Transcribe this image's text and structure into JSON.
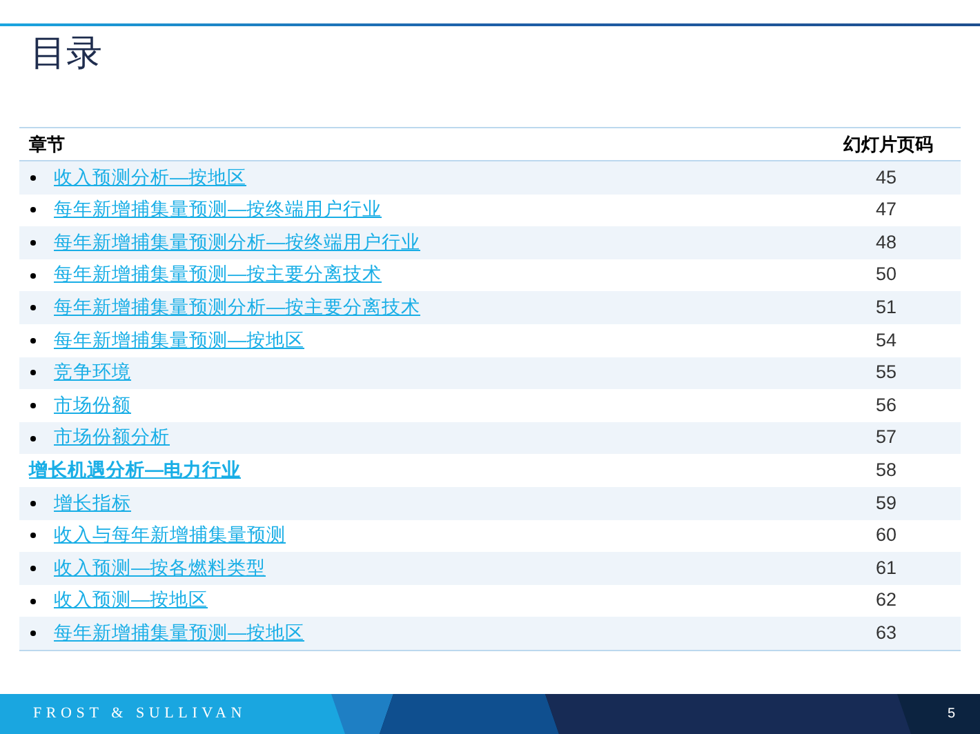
{
  "slide": {
    "title": "目录",
    "page_number": "5",
    "footer_logo": "FROST & SULLIVAN"
  },
  "table": {
    "columns": [
      "章节",
      "幻灯片页码"
    ],
    "rows": [
      {
        "kind": "sub",
        "label": "收入预测分析—按地区",
        "page": "45"
      },
      {
        "kind": "sub",
        "label": "每年新增捕集量预测—按终端用户行业",
        "page": "47"
      },
      {
        "kind": "sub",
        "label": "每年新增捕集量预测分析—按终端用户行业",
        "page": "48"
      },
      {
        "kind": "sub",
        "label": "每年新增捕集量预测—按主要分离技术",
        "page": "50"
      },
      {
        "kind": "sub",
        "label": "每年新增捕集量预测分析—按主要分离技术",
        "page": "51"
      },
      {
        "kind": "sub",
        "label": "每年新增捕集量预测—按地区",
        "page": "54"
      },
      {
        "kind": "sub",
        "label": "竞争环境",
        "page": "55"
      },
      {
        "kind": "sub",
        "label": "市场份额",
        "page": "56"
      },
      {
        "kind": "sub",
        "label": "市场份额分析",
        "page": "57"
      },
      {
        "kind": "section",
        "label": "增长机遇分析—电力行业",
        "page": "58"
      },
      {
        "kind": "sub",
        "label": "增长指标",
        "page": "59"
      },
      {
        "kind": "sub",
        "label": "收入与每年新增捕集量预测",
        "page": "60"
      },
      {
        "kind": "sub",
        "label": "收入预测—按各燃料类型",
        "page": "61"
      },
      {
        "kind": "sub",
        "label": "收入预测—按地区",
        "page": "62"
      },
      {
        "kind": "sub",
        "label": "每年新增捕集量预测—按地区",
        "page": "63"
      }
    ]
  }
}
